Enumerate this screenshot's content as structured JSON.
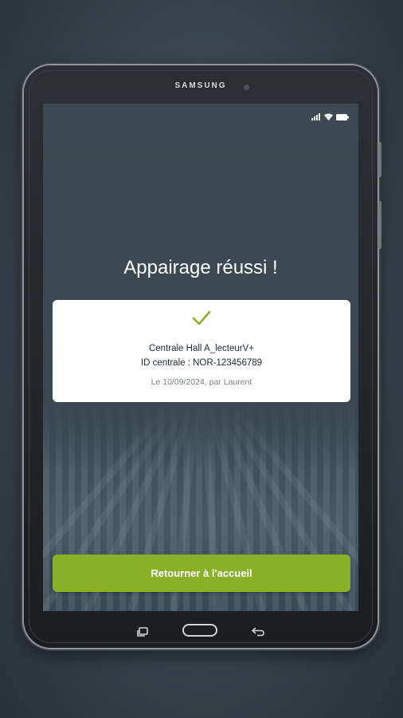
{
  "device": {
    "brand": "SAMSUNG"
  },
  "status_bar": {
    "icons": [
      "signal-icon",
      "wifi-icon",
      "battery-icon"
    ]
  },
  "screen": {
    "title": "Appairage réussi !",
    "card": {
      "icon": "check-icon",
      "device_name": "Centrale Hall A_lecteurV+",
      "central_id": "ID centrale : NOR-123456789",
      "paired_info": "Le 10/09/2024, par Laurent"
    },
    "primary_button": {
      "label": "Retourner à l'accueil"
    }
  },
  "nav_keys": [
    "recent-apps-icon",
    "home-button",
    "back-icon"
  ],
  "colors": {
    "accent": "#8ab027",
    "screen_background": "#3b4953",
    "card_background": "#ffffff",
    "text_primary": "#1f2a33",
    "text_secondary": "#7a8288"
  }
}
